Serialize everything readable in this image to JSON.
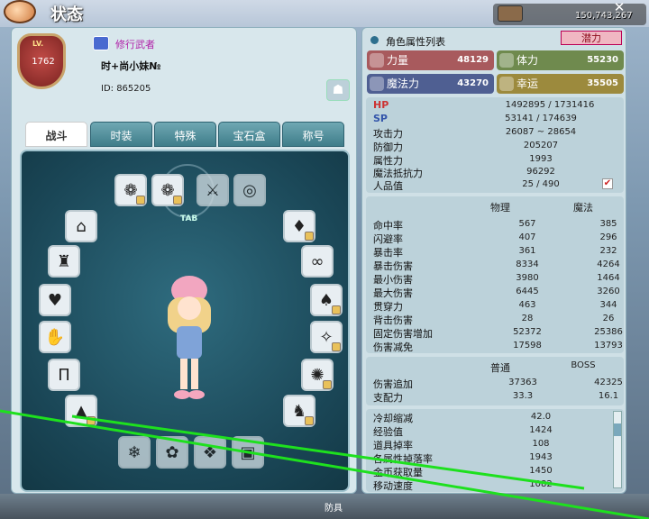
{
  "window": {
    "title": "状态",
    "close_label": "✕",
    "top_right_number": "150,743,267"
  },
  "profile": {
    "lv_label": "LV.",
    "level": "1762",
    "class_name": "修行武者",
    "player_name": "时+尚小妹№",
    "id_text": "ID:  865205"
  },
  "tabs": [
    "战斗",
    "时装",
    "特殊",
    "宝石盒",
    "称号"
  ],
  "equip": {
    "tab_hint": "TAB"
  },
  "attributes": {
    "title": "角色属性列表",
    "potential_label": "潜力",
    "primary": [
      {
        "label": "力量",
        "value": "48129",
        "color": "#a85a5d"
      },
      {
        "label": "体力",
        "value": "55230",
        "color": "#6f8a4e"
      },
      {
        "label": "魔法力",
        "value": "43270",
        "color": "#4f5f92"
      },
      {
        "label": "幸运",
        "value": "35505",
        "color": "#9c8a3d"
      }
    ],
    "basic": [
      {
        "label": "HP",
        "value": "1492895 / 1731416"
      },
      {
        "label": "SP",
        "value": "53141 / 174639"
      },
      {
        "label": "攻击力",
        "value": "26087 ~ 28654"
      },
      {
        "label": "防御力",
        "value": "205207"
      },
      {
        "label": "属性力",
        "value": "1993"
      },
      {
        "label": "魔法抵抗力",
        "value": "96292"
      },
      {
        "label": "人品值",
        "value": "25 / 490"
      }
    ],
    "combat_headers": [
      "物理",
      "魔法"
    ],
    "combat": [
      {
        "label": "命中率",
        "phys": "567",
        "mag": "385"
      },
      {
        "label": "闪避率",
        "phys": "407",
        "mag": "296"
      },
      {
        "label": "暴击率",
        "phys": "361",
        "mag": "232"
      },
      {
        "label": "暴击伤害",
        "phys": "8334",
        "mag": "4264"
      },
      {
        "label": "最小伤害",
        "phys": "3980",
        "mag": "1464"
      },
      {
        "label": "最大伤害",
        "phys": "6445",
        "mag": "3260"
      },
      {
        "label": "贯穿力",
        "phys": "463",
        "mag": "344"
      },
      {
        "label": "背击伤害",
        "phys": "28",
        "mag": "26"
      },
      {
        "label": "固定伤害增加",
        "phys": "52372",
        "mag": "25386"
      },
      {
        "label": "伤害减免",
        "phys": "17598",
        "mag": "13793"
      }
    ],
    "boss_headers": [
      "普通",
      "BOSS"
    ],
    "boss": [
      {
        "label": "伤害追加",
        "normal": "37363",
        "boss": "42325"
      },
      {
        "label": "支配力",
        "normal": "33.3",
        "boss": "16.1"
      }
    ],
    "misc": [
      {
        "label": "冷却缩减",
        "value": "42.0"
      },
      {
        "label": "经验值",
        "value": "1424"
      },
      {
        "label": "道具掉率",
        "value": "108"
      },
      {
        "label": "各属性掉落率",
        "value": "1943"
      },
      {
        "label": "金币获取量",
        "value": "1450"
      },
      {
        "label": "移动速度",
        "value": "1082"
      }
    ]
  },
  "bottom": {
    "text": "防具"
  }
}
